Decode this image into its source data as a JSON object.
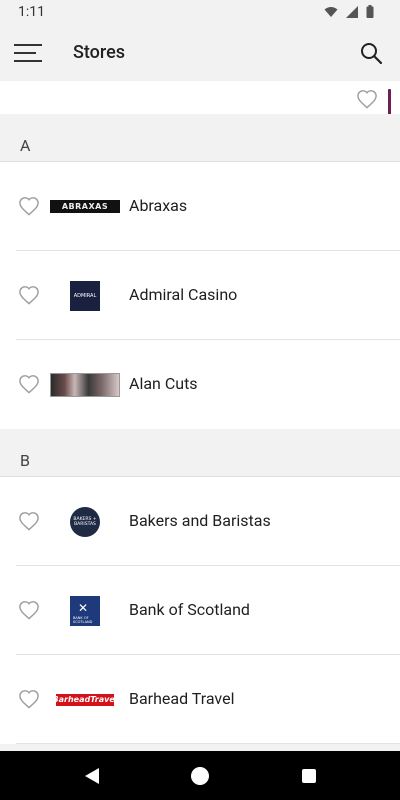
{
  "status_bar": {
    "time": "1:11",
    "icons": [
      "wifi-icon",
      "cellular-icon",
      "battery-icon"
    ]
  },
  "app_bar": {
    "title": "Stores",
    "menu_icon": "hamburger-menu-icon",
    "search_icon": "search-icon"
  },
  "sections": [
    {
      "letter": "A",
      "stores": [
        {
          "name": "Abraxas",
          "logo_text": "ABRAXAS"
        },
        {
          "name": "Admiral Casino",
          "logo_text": "ADMIRAL"
        },
        {
          "name": "Alan Cuts",
          "logo_text": ""
        }
      ]
    },
    {
      "letter": "B",
      "stores": [
        {
          "name": "Bakers and Baristas",
          "logo_text": "BAKERS + BARISTAS"
        },
        {
          "name": "Bank of Scotland",
          "logo_text": "BANK OF SCOTLAND"
        },
        {
          "name": "Barhead Travel",
          "logo_text": "BarheadTravel"
        }
      ]
    }
  ],
  "colors": {
    "accent": "#6d1e58",
    "background": "#f2f2f2",
    "list_background": "#ffffff",
    "heart_outline": "#9e9e9e"
  }
}
